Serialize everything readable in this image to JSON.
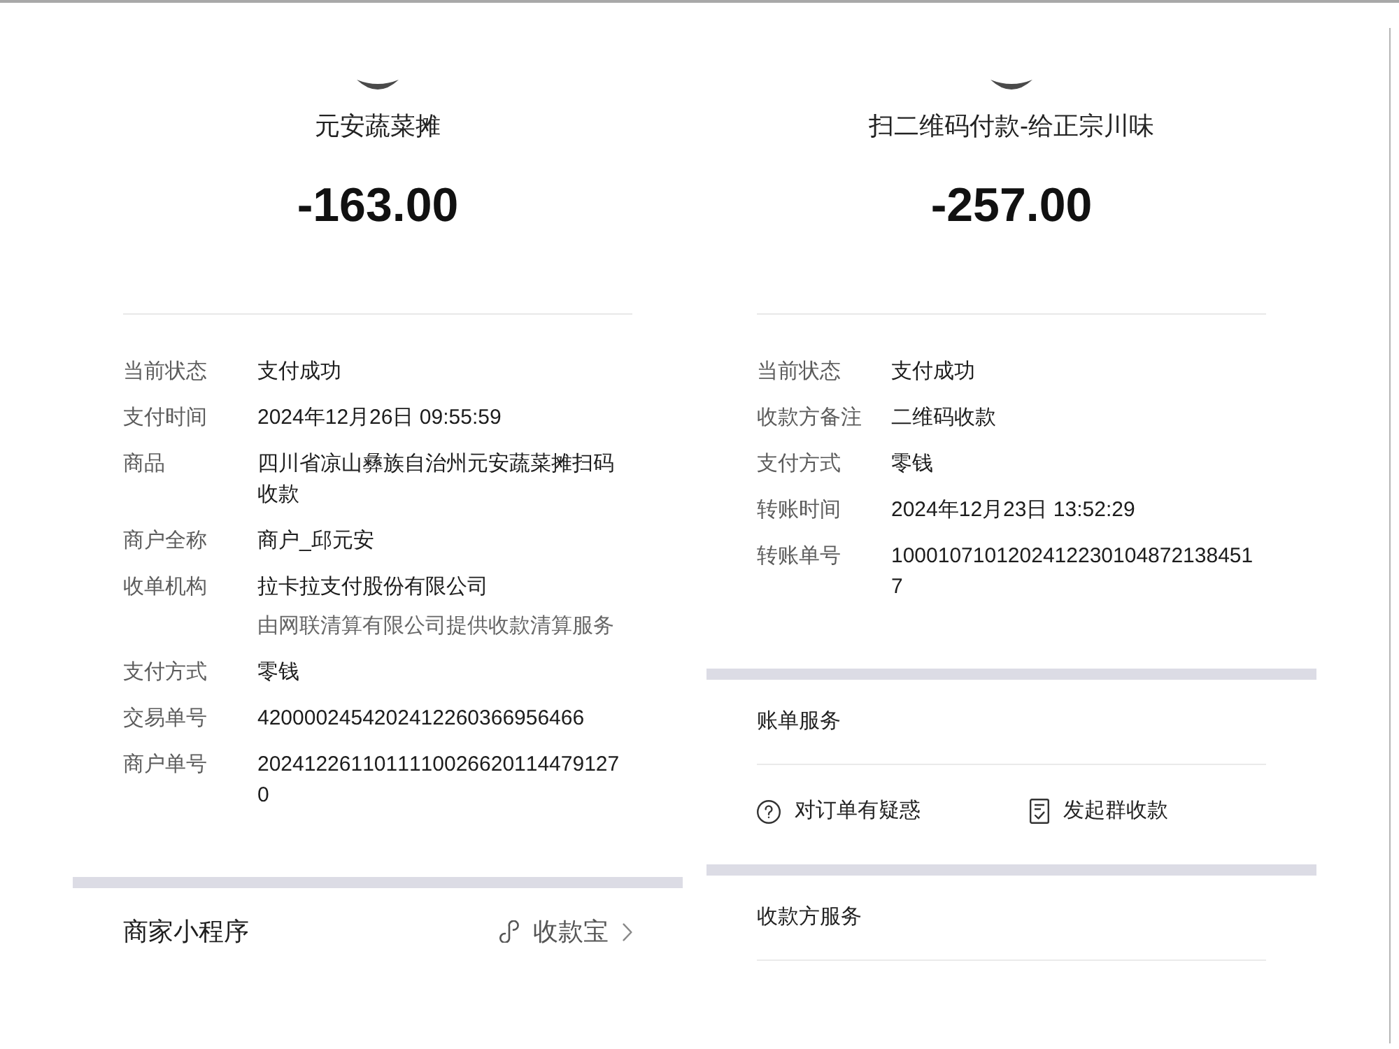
{
  "receipts": [
    {
      "title": "元安蔬菜摊",
      "amount": "-163.00",
      "details": [
        {
          "label": "当前状态",
          "value": "支付成功"
        },
        {
          "label": "支付时间",
          "value": "2024年12月26日 09:55:59"
        },
        {
          "label": "商品",
          "value": "四川省凉山彝族自治州元安蔬菜摊扫码收款"
        },
        {
          "label": "商户全称",
          "value": "商户_邱元安"
        },
        {
          "label": "收单机构",
          "value": "拉卡拉支付股份有限公司",
          "note": "由网联清算有限公司提供收款清算服务"
        },
        {
          "label": "支付方式",
          "value": "零钱"
        },
        {
          "label": "交易单号",
          "value": "4200002454202412260366956466"
        },
        {
          "label": "商户单号",
          "value": "20241226110111100266201144791270"
        }
      ],
      "sections": [
        {
          "kind": "mini_program",
          "title": "商家小程序",
          "link": "收款宝"
        }
      ]
    },
    {
      "title": "扫二维码付款-给正宗川味",
      "amount": "-257.00",
      "details": [
        {
          "label": "当前状态",
          "value": "支付成功"
        },
        {
          "label": "收款方备注",
          "value": "二维码收款"
        },
        {
          "label": "支付方式",
          "value": "零钱"
        },
        {
          "label": "转账时间",
          "value": "2024年12月23日 13:52:29"
        },
        {
          "label": "转账单号",
          "value": "10001071012024122301048721384517"
        }
      ],
      "sections": [
        {
          "kind": "services",
          "title": "账单服务",
          "actions": [
            {
              "kind": "question",
              "label": "对订单有疑惑"
            },
            {
              "kind": "group_collect",
              "label": "发起群收款"
            }
          ]
        },
        {
          "kind": "services",
          "title": "收款方服务"
        }
      ]
    }
  ]
}
